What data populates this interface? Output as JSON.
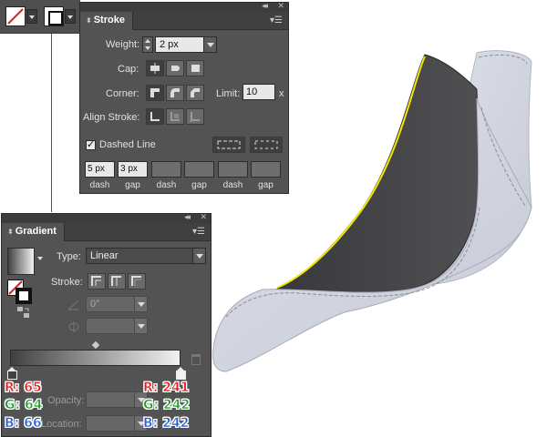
{
  "stroke_panel": {
    "title": "Stroke",
    "weight_label": "Weight:",
    "weight_value": "2 px",
    "cap_label": "Cap:",
    "corner_label": "Corner:",
    "limit_label": "Limit:",
    "limit_value": "10",
    "limit_unit": "x",
    "align_label": "Align Stroke:",
    "dashed_label": "Dashed Line",
    "dash_values": [
      "5 px",
      "3 px",
      "",
      "",
      "",
      ""
    ],
    "dash_labels": [
      "dash",
      "gap",
      "dash",
      "gap",
      "dash",
      "gap"
    ]
  },
  "gradient_panel": {
    "title": "Gradient",
    "type_label": "Type:",
    "type_value": "Linear",
    "stroke_label": "Stroke:",
    "angle_value": "0°",
    "opacity_label": "Opacity:",
    "location_label": "Location:"
  },
  "annotations": {
    "left_r": "R: 65",
    "left_g": "G: 64",
    "left_b": "B: 66",
    "right_r": "R: 241",
    "right_g": "G: 242",
    "right_b": "B: 242"
  },
  "colors": {
    "gradient_start": "#414142",
    "gradient_end": "#f1f2f2",
    "shoe_body": "#d6d9e3",
    "shoe_lining": "#3f3f40",
    "highlight_stroke": "#f1e800"
  }
}
